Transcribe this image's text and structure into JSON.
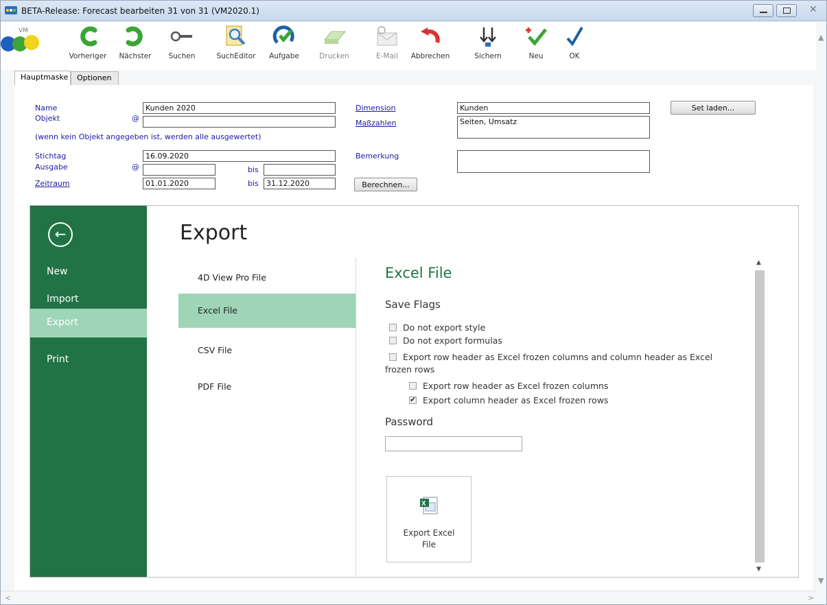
{
  "window": {
    "title": "BETA-Release: Forecast  bearbeiten 31 von 31 (VM2020.1)",
    "close_glyph": "✕"
  },
  "toolbar": {
    "logo_text": "VM",
    "buttons": [
      {
        "label": "Vorheriger",
        "icon": "arrow-left-green-icon"
      },
      {
        "label": "Nächster",
        "icon": "arrow-right-green-icon"
      },
      {
        "label": "Suchen",
        "icon": "key-search-icon"
      },
      {
        "label": "SuchEditor",
        "icon": "magnifier-document-icon"
      },
      {
        "label": "Aufgabe",
        "icon": "refresh-check-icon"
      },
      {
        "label": "Drucken",
        "icon": "printer-icon"
      },
      {
        "label": "E-Mail",
        "icon": "email-icon"
      },
      {
        "label": "Abbrechen",
        "icon": "undo-red-icon"
      },
      {
        "label": "Sichern",
        "icon": "save-arrows-icon"
      },
      {
        "label": "Neu",
        "icon": "new-plus-check-icon"
      },
      {
        "label": "OK",
        "icon": "check-icon"
      }
    ]
  },
  "tabs": [
    {
      "label": "Hauptmaske"
    },
    {
      "label": "Optionen"
    }
  ],
  "form": {
    "name_label": "Name",
    "name_value": "Kunden 2020",
    "objekt_label": "Objekt",
    "objekt_value": "",
    "objekt_hint": "(wenn kein Objekt angegeben ist, werden alle ausgewertet)",
    "at_symbol": "@",
    "stichtag_label": "Stichtag",
    "stichtag_value": "16.09.2020",
    "ausgabe_label": "Ausgabe",
    "ausgabe_from": "",
    "ausgabe_to": "",
    "zeitraum_label": "Zeitraum",
    "zeitraum_from": "01.01.2020",
    "zeitraum_to": "31.12.2020",
    "bis_label": "bis",
    "dimension_label": "Dimension",
    "dimension_value": "Kunden",
    "masszahlen_label": "Maßzahlen",
    "masszahlen_value": "Seiten, Umsatz",
    "bemerkung_label": "Bemerkung",
    "bemerkung_value": "",
    "set_laden_button": "Set laden...",
    "berechnen_button": "Berechnen..."
  },
  "export_dialog": {
    "back_glyph": "←",
    "nav": [
      {
        "label": "New"
      },
      {
        "label": "Import"
      },
      {
        "label": "Export"
      },
      {
        "label": "Print"
      }
    ],
    "active_nav": "Export",
    "heading": "Export",
    "formats": [
      {
        "label": "4D View Pro File"
      },
      {
        "label": "Excel File"
      },
      {
        "label": "CSV File"
      },
      {
        "label": "PDF File"
      }
    ],
    "active_format": "Excel File",
    "pane_title": "Excel File",
    "save_flags_heading": "Save Flags",
    "flags": [
      {
        "label": "Do not export style",
        "checked": false
      },
      {
        "label": "Do not export formulas",
        "checked": false
      },
      {
        "label": "Export row header as Excel frozen columns and column header as Excel",
        "checked": false
      },
      {
        "label": "frozen rows",
        "checked": false
      },
      {
        "label": "Export row header as Excel frozen columns",
        "checked": false
      },
      {
        "label": "Export column header as Excel frozen rows",
        "checked": true
      }
    ],
    "password_heading": "Password",
    "password_value": "",
    "export_button_line1": "Export Excel",
    "export_button_line2": "File"
  },
  "scroll_glyphs": {
    "up": "▲",
    "down": "▼",
    "left": "<",
    "right": ">"
  },
  "colors": {
    "excel_green": "#217346",
    "active_item": "#9fd5b7",
    "label_blue": "#1a1aa8"
  }
}
